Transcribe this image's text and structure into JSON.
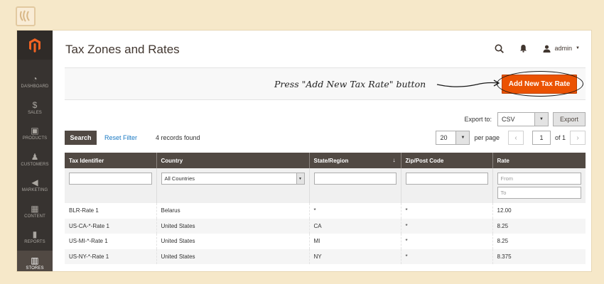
{
  "sidebar": {
    "items": [
      {
        "label": "DASHBOARD",
        "icon": "dashboard-icon",
        "glyph": "◔",
        "active": false
      },
      {
        "label": "SALES",
        "icon": "dollar-icon",
        "glyph": "$",
        "active": false
      },
      {
        "label": "PRODUCTS",
        "icon": "box-icon",
        "glyph": "▣",
        "active": false
      },
      {
        "label": "CUSTOMERS",
        "icon": "person-icon",
        "glyph": "♟",
        "active": false
      },
      {
        "label": "MARKETING",
        "icon": "megaphone-icon",
        "glyph": "◀",
        "active": false
      },
      {
        "label": "CONTENT",
        "icon": "content-icon",
        "glyph": "▦",
        "active": false
      },
      {
        "label": "REPORTS",
        "icon": "bar-chart-icon",
        "glyph": "▮",
        "active": false
      },
      {
        "label": "STORES",
        "icon": "store-icon",
        "glyph": "▥",
        "active": true
      }
    ]
  },
  "header": {
    "title": "Tax Zones and Rates",
    "user": "admin"
  },
  "action_bar": {
    "instruction": "Press \"Add New Tax Rate\" button",
    "add_button": "Add New Tax Rate"
  },
  "export": {
    "label": "Export to:",
    "format": "CSV",
    "button": "Export"
  },
  "toolbar": {
    "search": "Search",
    "reset": "Reset Filter",
    "records": "4 records found",
    "per_page_value": "20",
    "per_page_label": "per page",
    "page": "1",
    "of": "of 1"
  },
  "grid": {
    "columns": [
      "Tax Identifier",
      "Country",
      "State/Region",
      "Zip/Post Code",
      "Rate"
    ],
    "filters": {
      "country": "All Countries",
      "rate_from": "From",
      "rate_to": "To"
    },
    "rows": [
      [
        "BLR-Rate 1",
        "Belarus",
        "*",
        "*",
        "12.00"
      ],
      [
        "US-CA-*-Rate 1",
        "United States",
        "CA",
        "*",
        "8.25"
      ],
      [
        "US-MI-*-Rate 1",
        "United States",
        "MI",
        "*",
        "8.25"
      ],
      [
        "US-NY-*-Rate 1",
        "United States",
        "NY",
        "*",
        "8.375"
      ]
    ]
  },
  "colors": {
    "accent": "#eb5202",
    "sidebar": "#373330",
    "header_row": "#514943",
    "link": "#1979c3",
    "background": "#f6e8c9"
  }
}
